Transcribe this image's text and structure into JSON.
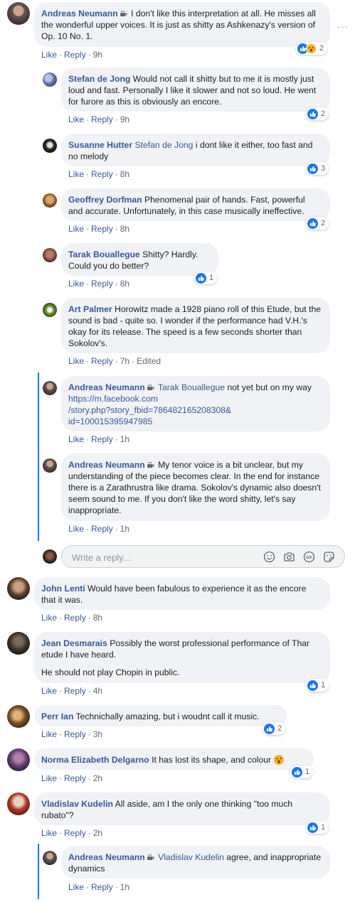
{
  "comments": [
    {
      "author": "Andreas Neumann",
      "cup": true,
      "mention": "",
      "text": "I don't like this interpretation at all. He misses all the wonderful upper voices. It is just as shitty as Ashkenazy's version of Op. 10 No. 1.",
      "time": "9h",
      "edited": "",
      "reactions": "2"
    },
    {
      "author": "Stefan de Jong",
      "cup": false,
      "mention": "",
      "text": "Would not call it shitty but to me it is mostly just loud and fast. Personally I like it slower and not so loud. He went for furore as this is obviously an encore.",
      "time": "9h",
      "edited": "",
      "reactions": "2"
    },
    {
      "author": "Susanne Hutter",
      "cup": false,
      "mention": "Stefan de Jong",
      "text": "i dont like it either, too fast and no melody",
      "time": "8h",
      "edited": "",
      "reactions": "3"
    },
    {
      "author": "Geoffrey Dorfman",
      "cup": false,
      "mention": "",
      "text": "Phenomenal pair of hands. Fast, powerful and accurate. Unfortunately, in this case musically ineffective.",
      "time": "8h",
      "edited": "",
      "reactions": "2"
    },
    {
      "author": "Tarak Bouallegue",
      "cup": false,
      "mention": "",
      "text": "Shitty? Hardly.",
      "text2": "Could you do better?",
      "time": "8h",
      "edited": "",
      "reactions": "1"
    },
    {
      "author": "Art Palmer",
      "cup": false,
      "mention": "",
      "text": "Horowitz made a 1928 piano roll of this Etude, but the sound is bad - quite so. I wonder if the performance had V.H.'s okay for its release. The speed is a few seconds shorter than Sokolov's.",
      "time": "7h",
      "edited": "Edited",
      "reactions": ""
    },
    {
      "author": "Andreas Neumann",
      "cup": true,
      "mention": "Tarak Bouallegue",
      "text": "not yet but on my way",
      "link": "https://m.facebook.com/story.php?story_fbid=786482165208308&id=100015395947985",
      "link_l1": "https://m.facebook.com",
      "link_l2": "/story.php?story_fbid=786482165208308&",
      "link_l3": "id=100015395947985",
      "time": "1h",
      "edited": "",
      "reactions": ""
    },
    {
      "author": "Andreas Neumann",
      "cup": true,
      "mention": "",
      "text": "My tenor voice is a bit unclear, but my understanding of the piece becomes clear. In the end for instance there is a Zarathrustra like drama. Sokolov's dynamic also doesn't seem sound to me. If you don't like the word shitty, let's say inappropriate.",
      "time": "1h",
      "edited": "",
      "reactions": ""
    },
    {
      "author": "John Lenti",
      "cup": false,
      "mention": "",
      "text": "Would have been fabulous to experience it as the encore that it was.",
      "time": "8h",
      "edited": "",
      "reactions": ""
    },
    {
      "author": "Jean Desmarais",
      "cup": false,
      "mention": "",
      "text": "Possibly the worst professional performance of Thar etude I have heard.",
      "text2": "He should not play Chopin in public.",
      "time": "4h",
      "edited": "",
      "reactions": "1"
    },
    {
      "author": "Perr Ian",
      "cup": false,
      "mention": "",
      "text": "Technichally amazing, but i woudnt call it music.",
      "time": "3h",
      "edited": "",
      "reactions": "2"
    },
    {
      "author": "Norma Elizabeth Delgarno",
      "cup": false,
      "mention": "",
      "text": "It has lost its shape, and colour",
      "time": "2h",
      "edited": "",
      "reactions": "1"
    },
    {
      "author": "Vladislav Kudelin",
      "cup": false,
      "mention": "",
      "text": "All aside, am I the only one thinking \"too much rubato\"?",
      "time": "2h",
      "edited": "",
      "reactions": "1"
    },
    {
      "author": "Andreas Neumann",
      "cup": true,
      "mention": "Vladislav Kudelin",
      "text": "agree, and inappropriate dynamics",
      "time": "1h",
      "edited": "",
      "reactions": ""
    }
  ],
  "actions": {
    "like": "Like",
    "reply": "Reply",
    "separator": "·"
  },
  "reply_box": {
    "placeholder": "Write a reply..."
  },
  "more_label": "···",
  "colors": {
    "link": "#385898",
    "bubble": "#f0f2f5",
    "like": "#1877f2",
    "thread": "#1877f2"
  }
}
